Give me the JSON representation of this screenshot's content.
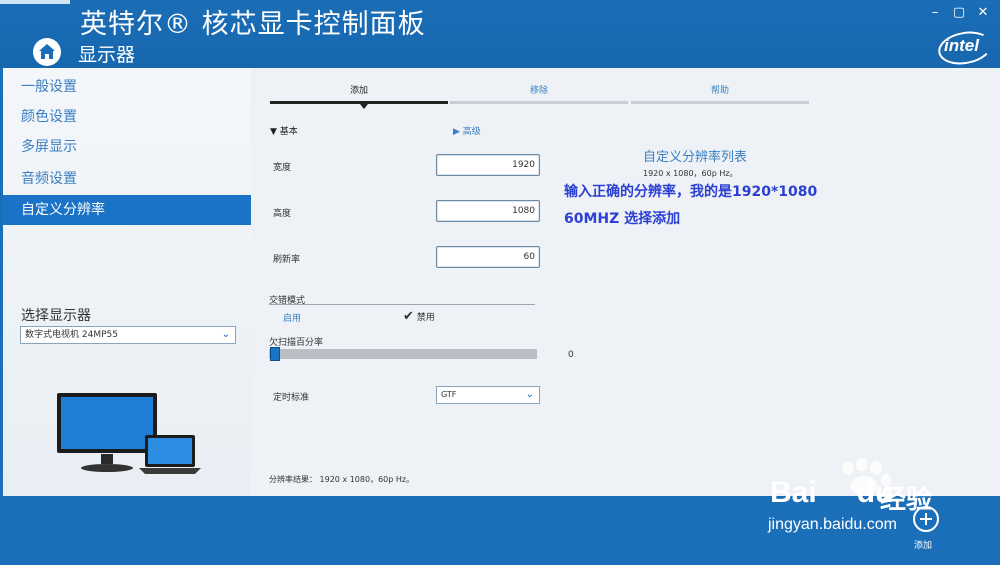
{
  "header": {
    "app_title": "英特尔® 核芯显卡控制面板",
    "section_title": "显示器",
    "brand_logo": "intel",
    "window_controls": [
      "minimize",
      "maximize",
      "close"
    ]
  },
  "sidebar": {
    "items": [
      {
        "label": "一般设置",
        "active": false
      },
      {
        "label": "颜色设置",
        "active": false
      },
      {
        "label": "多屏显示",
        "active": false
      },
      {
        "label": "音频设置",
        "active": false
      },
      {
        "label": "自定义分辨率",
        "active": true
      }
    ],
    "select_display_label": "选择显示器",
    "selected_display": "数字式电视机 24MP55"
  },
  "tabs": [
    {
      "label": "添加",
      "active": true
    },
    {
      "label": "移除",
      "active": false
    },
    {
      "label": "帮助",
      "active": false
    }
  ],
  "form": {
    "basic_label": "基本",
    "advanced_label": "高级",
    "width_label": "宽度",
    "width_value": "1920",
    "height_label": "高度",
    "height_value": "1080",
    "refresh_label": "刷新率",
    "refresh_value": "60",
    "interlace_label": "交错模式",
    "interlace_enable": "启用",
    "interlace_disable": "禁用",
    "interlace_selected": "禁用",
    "underscan_label": "欠扫描百分率",
    "underscan_value": "0",
    "timing_label": "定时标准",
    "timing_value": "GTF"
  },
  "custom_list": {
    "title": "自定义分辨率列表",
    "items": [
      "1920 x 1080，60p Hz。"
    ]
  },
  "annotation": {
    "line1": "输入正确的分辨率，我的是1920*1080",
    "line2": "60MHZ  选择添加"
  },
  "result_text": "分辨率结果： 1920 x 1080，60p Hz。",
  "footer": {
    "add_label": "添加"
  },
  "watermark": {
    "brand": "Bai",
    "brand_suffix": "du",
    "cn": "经验",
    "url": "jingyan.baidu.com"
  },
  "colors": {
    "header_blue": "#1a6db6",
    "active_nav": "#1a73c6",
    "link_blue": "#3a7fc1",
    "annotation": "#2c3fd3"
  }
}
